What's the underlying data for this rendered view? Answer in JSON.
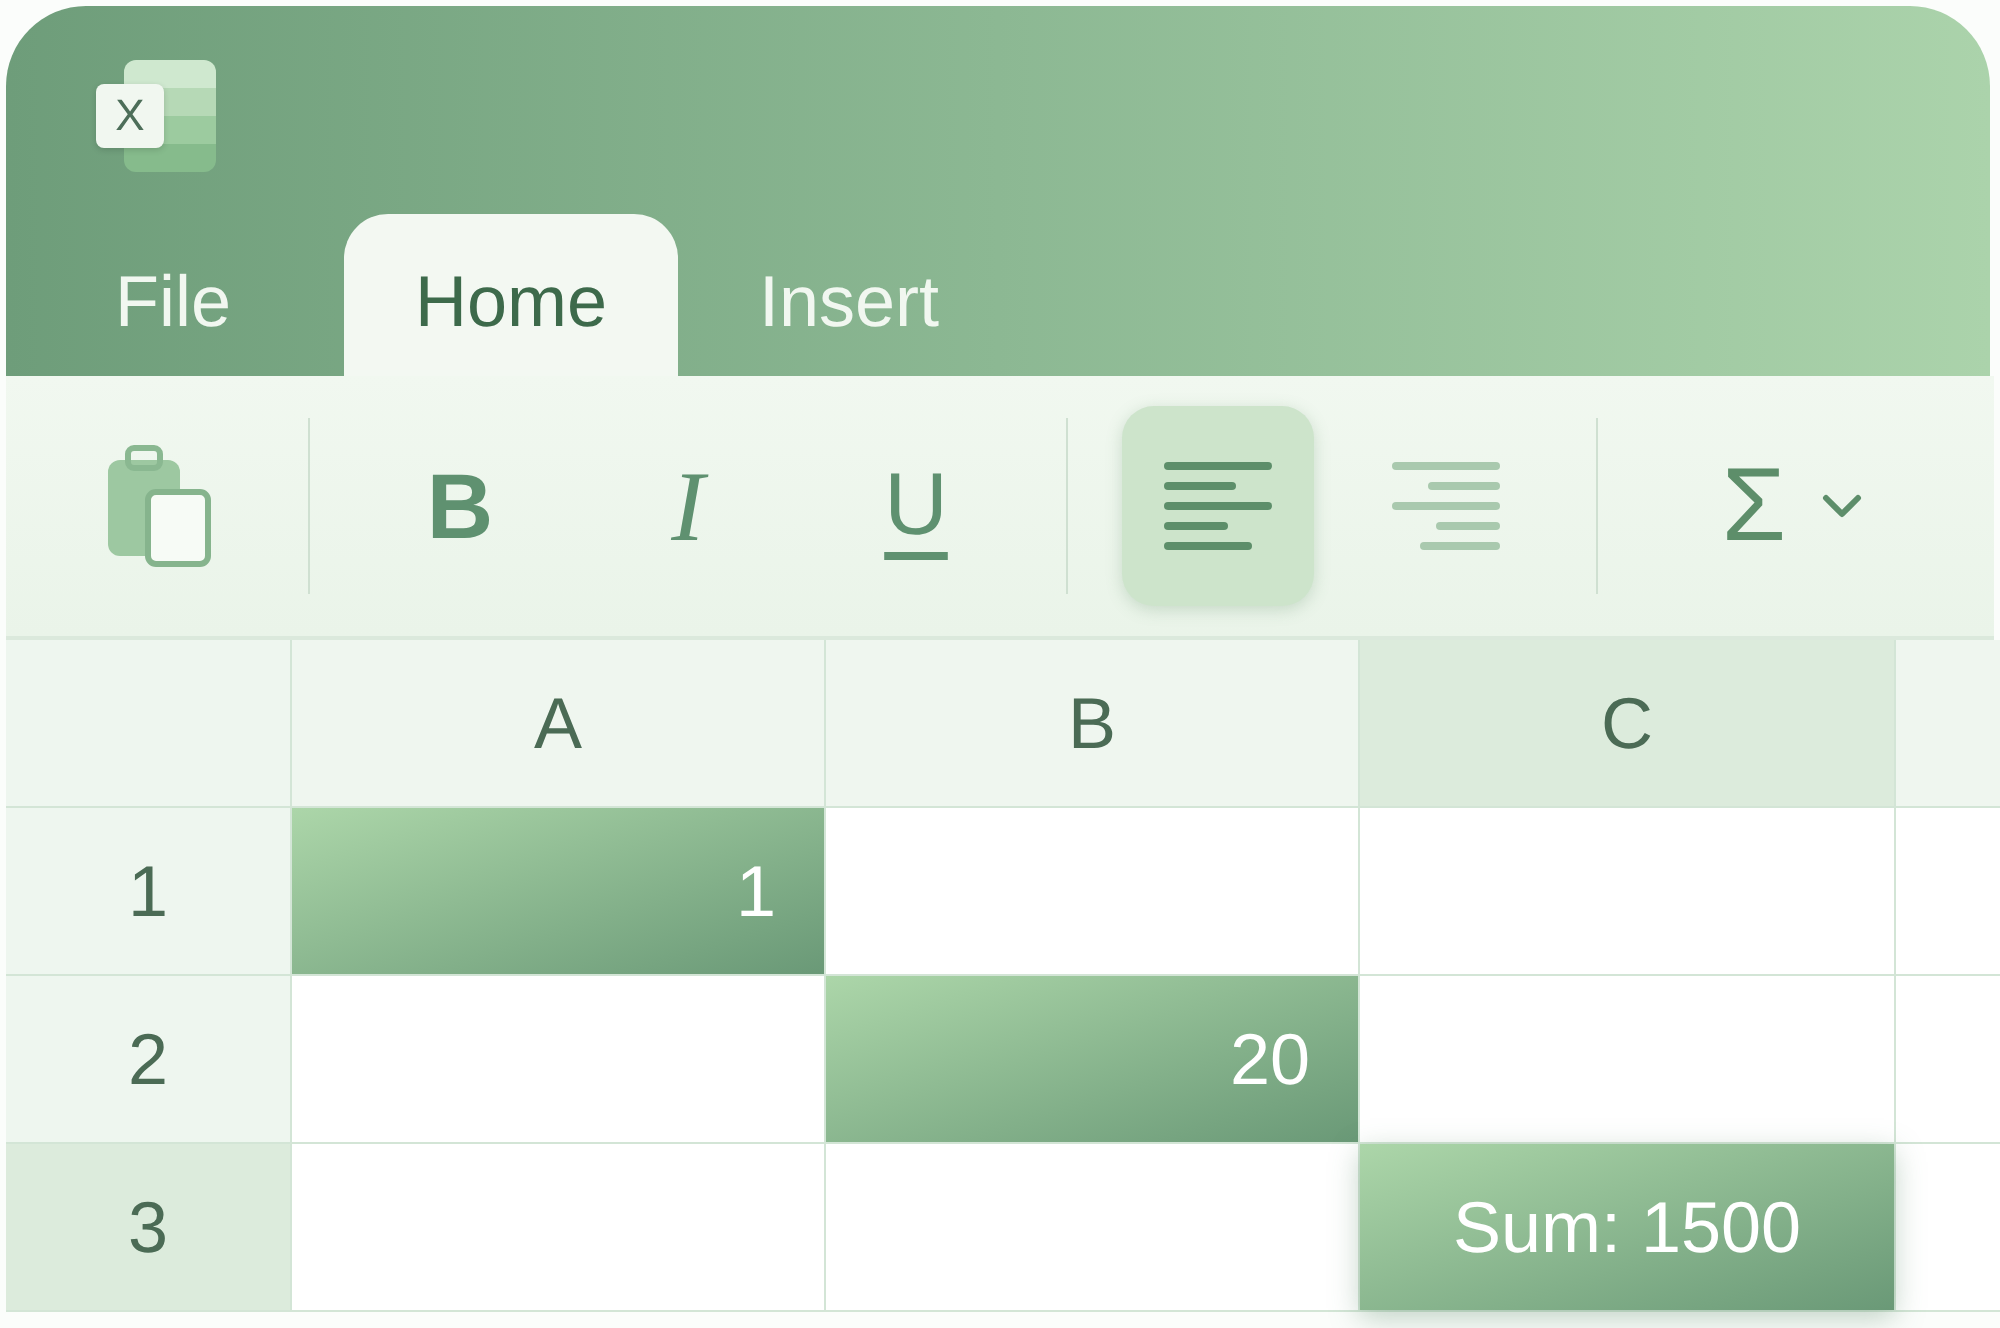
{
  "app": {
    "logo_letter": "X"
  },
  "tabs": [
    {
      "label": "File",
      "selected": false
    },
    {
      "label": "Home",
      "selected": true
    },
    {
      "label": "Insert",
      "selected": false
    }
  ],
  "toolbar": {
    "groups": [
      {
        "items": [
          {
            "kind": "paste",
            "selected": false
          }
        ]
      },
      {
        "items": [
          {
            "kind": "bold",
            "label": "B",
            "selected": false
          },
          {
            "kind": "italic",
            "label": "I",
            "selected": false
          },
          {
            "kind": "underline",
            "label": "U",
            "selected": false
          }
        ]
      },
      {
        "items": [
          {
            "kind": "align-left",
            "selected": true
          },
          {
            "kind": "align-right",
            "selected": false
          }
        ]
      },
      {
        "items": [
          {
            "kind": "autosum",
            "label": "Σ",
            "selected": false
          }
        ]
      }
    ]
  },
  "sheet": {
    "columns": [
      {
        "label": "A",
        "selected": false
      },
      {
        "label": "B",
        "selected": false
      },
      {
        "label": "C",
        "selected": true
      }
    ],
    "rows": [
      {
        "label": "1",
        "selected": false,
        "cells": [
          {
            "kind": "number",
            "selected": true,
            "value": "1"
          },
          {
            "kind": "empty",
            "selected": false
          },
          {
            "kind": "empty",
            "selected": false
          }
        ]
      },
      {
        "label": "2",
        "selected": false,
        "cells": [
          {
            "kind": "empty",
            "selected": false
          },
          {
            "kind": "number",
            "selected": true,
            "value": "20"
          },
          {
            "kind": "empty",
            "selected": false
          }
        ]
      },
      {
        "label": "3",
        "selected": true,
        "cells": [
          {
            "kind": "empty",
            "selected": false
          },
          {
            "kind": "empty",
            "selected": false
          },
          {
            "kind": "sum",
            "selected": true,
            "value": "Sum: 1500"
          }
        ]
      }
    ]
  }
}
